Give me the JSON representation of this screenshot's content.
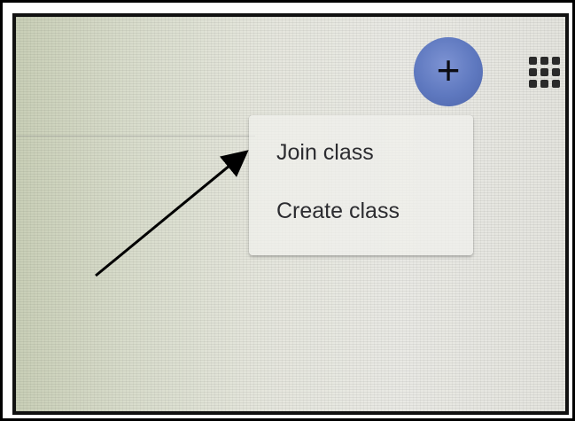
{
  "header": {
    "add_button_icon": "plus-icon",
    "add_button_symbol": "+",
    "apps_icon": "apps-grid-icon",
    "accent_color": "#5e78bf"
  },
  "menu": {
    "items": [
      {
        "label": "Join class"
      },
      {
        "label": "Create class"
      }
    ]
  },
  "annotation": {
    "arrow_icon": "arrow-annotation",
    "arrow_color": "#000000"
  }
}
